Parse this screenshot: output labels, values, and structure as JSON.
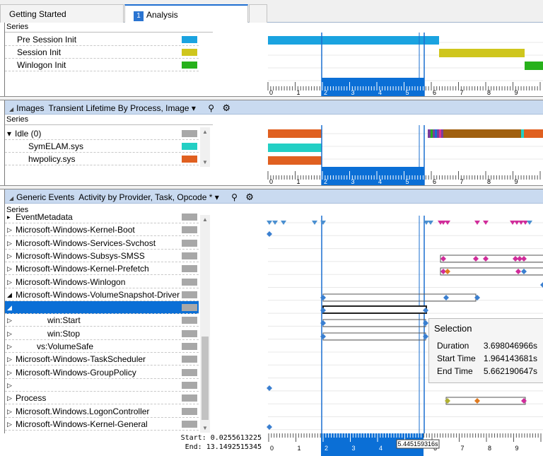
{
  "tabs": [
    {
      "label": "Getting Started",
      "active": false
    },
    {
      "label": "Analysis",
      "number": "1",
      "active": true
    }
  ],
  "top_panel": {
    "series_header": "Series",
    "rows": [
      {
        "label": "Pre Session Init",
        "color": "#1aa3e0"
      },
      {
        "label": "Session Init",
        "color": "#cfc61d"
      },
      {
        "label": "Winlogon Init",
        "color": "#27b11b"
      }
    ]
  },
  "images_panel": {
    "title": "Images",
    "view": "Transient Lifetime By Process, Image",
    "series_header": "Series",
    "rows": [
      {
        "label": "Idle (0)",
        "color": "#a8a8a8"
      },
      {
        "label": "SymELAM.sys",
        "color": "#23cfc4"
      },
      {
        "label": "hwpolicy.sys",
        "color": "#e06020"
      }
    ]
  },
  "generic_panel": {
    "title": "Generic Events",
    "view": "Activity by Provider, Task, Opcode *",
    "series_header": "Series",
    "rows": [
      {
        "label": "EventMetadata",
        "glyph": "▸"
      },
      {
        "label": "Microsoft-Windows-Kernel-Boot",
        "glyph": "▷"
      },
      {
        "label": "Microsoft-Windows-Services-Svchost",
        "glyph": "▷"
      },
      {
        "label": "Microsoft-Windows-Subsys-SMSS",
        "glyph": "▷"
      },
      {
        "label": "Microsoft-Windows-Kernel-Prefetch",
        "glyph": "▷"
      },
      {
        "label": "Microsoft-Windows-Winlogon",
        "glyph": "▷"
      },
      {
        "label": "Microsoft-Windows-VolumeSnapshot-Driver",
        "glyph": "◢"
      },
      {
        "label": "",
        "glyph": "◢"
      },
      {
        "label": "win:Start",
        "glyph": "▷"
      },
      {
        "label": "win:Stop",
        "glyph": "▷"
      },
      {
        "label": "vs:VolumeSafe",
        "glyph": "▷"
      },
      {
        "label": "Microsoft-Windows-TaskScheduler",
        "glyph": "▷"
      },
      {
        "label": "Microsoft-Windows-GroupPolicy",
        "glyph": "▷"
      },
      {
        "label": "",
        "glyph": "▷"
      },
      {
        "label": "Process",
        "glyph": "▷"
      },
      {
        "label": "Microsoft.Windows.LogonController",
        "glyph": "▷"
      },
      {
        "label": "Microsoft-Windows-Kernel-General",
        "glyph": "▷"
      }
    ]
  },
  "axis": {
    "ticks": [
      "0",
      "1",
      "2",
      "3",
      "4",
      "5",
      "6",
      "7",
      "8",
      "9"
    ]
  },
  "tooltip": {
    "title": "Selection",
    "duration_label": "Duration",
    "duration_value": "3.698046966s",
    "start_label": "Start Time",
    "start_value": "1.964143681s",
    "end_label": "End Time",
    "end_value": "5.662190647s"
  },
  "footer": {
    "start_label": "Start:",
    "start_value": "0.0255613225",
    "end_label": "End:",
    "end_value": "13.1492515345",
    "cursor_value": "5.445159316s"
  },
  "colors": {
    "accent": "#0b6fd6",
    "header": "#c9daf0"
  }
}
